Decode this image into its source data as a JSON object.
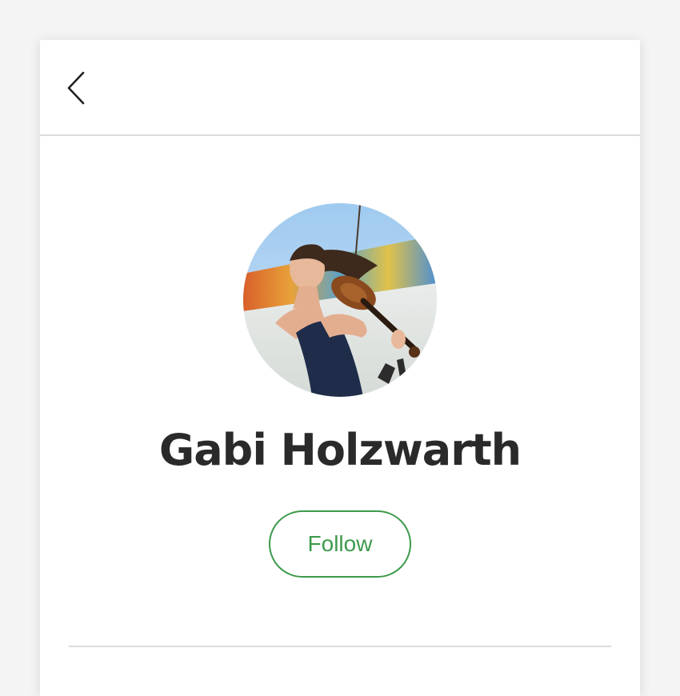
{
  "header": {
    "back_icon": "chevron-left-icon"
  },
  "profile": {
    "name": "Gabi Holzwarth",
    "avatar_description_icon": "profile-photo",
    "follow_label": "Follow"
  },
  "colors": {
    "accent": "#3e9a4c",
    "name_text": "#2a2a2a",
    "divider": "#dcdcdc"
  }
}
